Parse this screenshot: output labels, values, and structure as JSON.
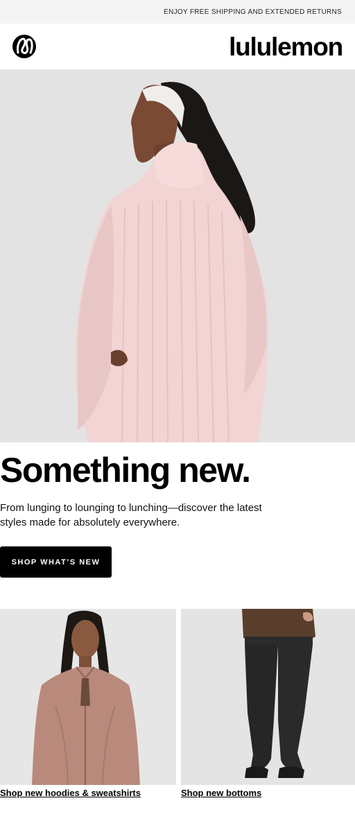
{
  "promo_bar": {
    "text": "ENJOY FREE SHIPPING AND EXTENDED RETURNS"
  },
  "header": {
    "logo_icon": "lululemon-logo-icon",
    "wordmark": "lululemon"
  },
  "hero": {
    "image": "woman-in-pink-knit-funnel-neck-sweater"
  },
  "main": {
    "headline": "Something new.",
    "body": "From lunging to lounging to lunching—discover the latest styles made for absolutely everywhere.",
    "cta_label": "SHOP WHAT’S NEW"
  },
  "tiles": [
    {
      "image": "woman-in-mauve-zip-jacket",
      "link_label": "Shop new hoodies & sweatshirts"
    },
    {
      "image": "model-in-black-flared-pants",
      "link_label": "Shop new bottoms"
    }
  ],
  "colors": {
    "brand": "#000000",
    "promo_bg": "#f4f4f4",
    "sweater_pink": "#f0d2d2"
  }
}
